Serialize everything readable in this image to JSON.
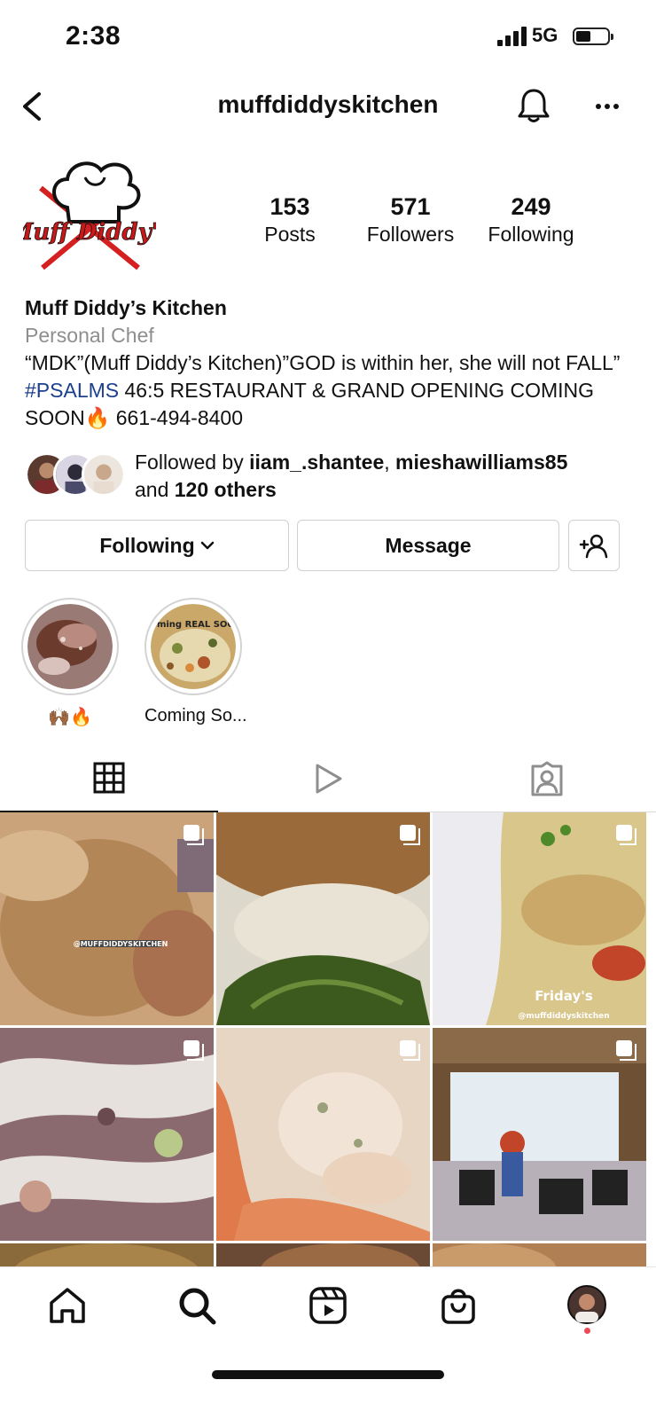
{
  "status_bar": {
    "time": "2:38",
    "network": "5G"
  },
  "header": {
    "handle": "muffdiddyskitchen"
  },
  "profile": {
    "avatar_text": "Muff Diddy's",
    "stats": [
      {
        "value": "153",
        "label": "Posts"
      },
      {
        "value": "571",
        "label": "Followers"
      },
      {
        "value": "249",
        "label": "Following"
      }
    ],
    "display_name": "Muff Diddy’s Kitchen",
    "category": "Personal Chef",
    "bio_part1": "“MDK”(Muff Diddy’s Kitchen)”GOD is within her, she will not FALL” ",
    "bio_hashtag": "#PSALMS",
    "bio_part2": " 46:5 RESTAURANT & GRAND OPENING COMING SOON🔥 661-494-8400"
  },
  "followed_by": {
    "prefix": "Followed by ",
    "user1": "iiam_.shantee",
    "sep": ", ",
    "user2": "mieshawilliams85",
    "and": "and ",
    "others": "120 others"
  },
  "actions": {
    "following_label": "Following",
    "message_label": "Message"
  },
  "highlights": [
    {
      "label": "🙌🏾🔥"
    },
    {
      "label": "Coming So...",
      "overlay": "Coming REAL SOON"
    }
  ],
  "grid_captions": {
    "post1": "@MUFFDIDDYSKITCHEN",
    "post3_title": "Friday's",
    "post3_handle": "@muffdiddyskitchen"
  },
  "colors": {
    "hashtag": "#1c3f8f",
    "notification_dot": "#ed4956",
    "divider": "#dbdbdb"
  }
}
